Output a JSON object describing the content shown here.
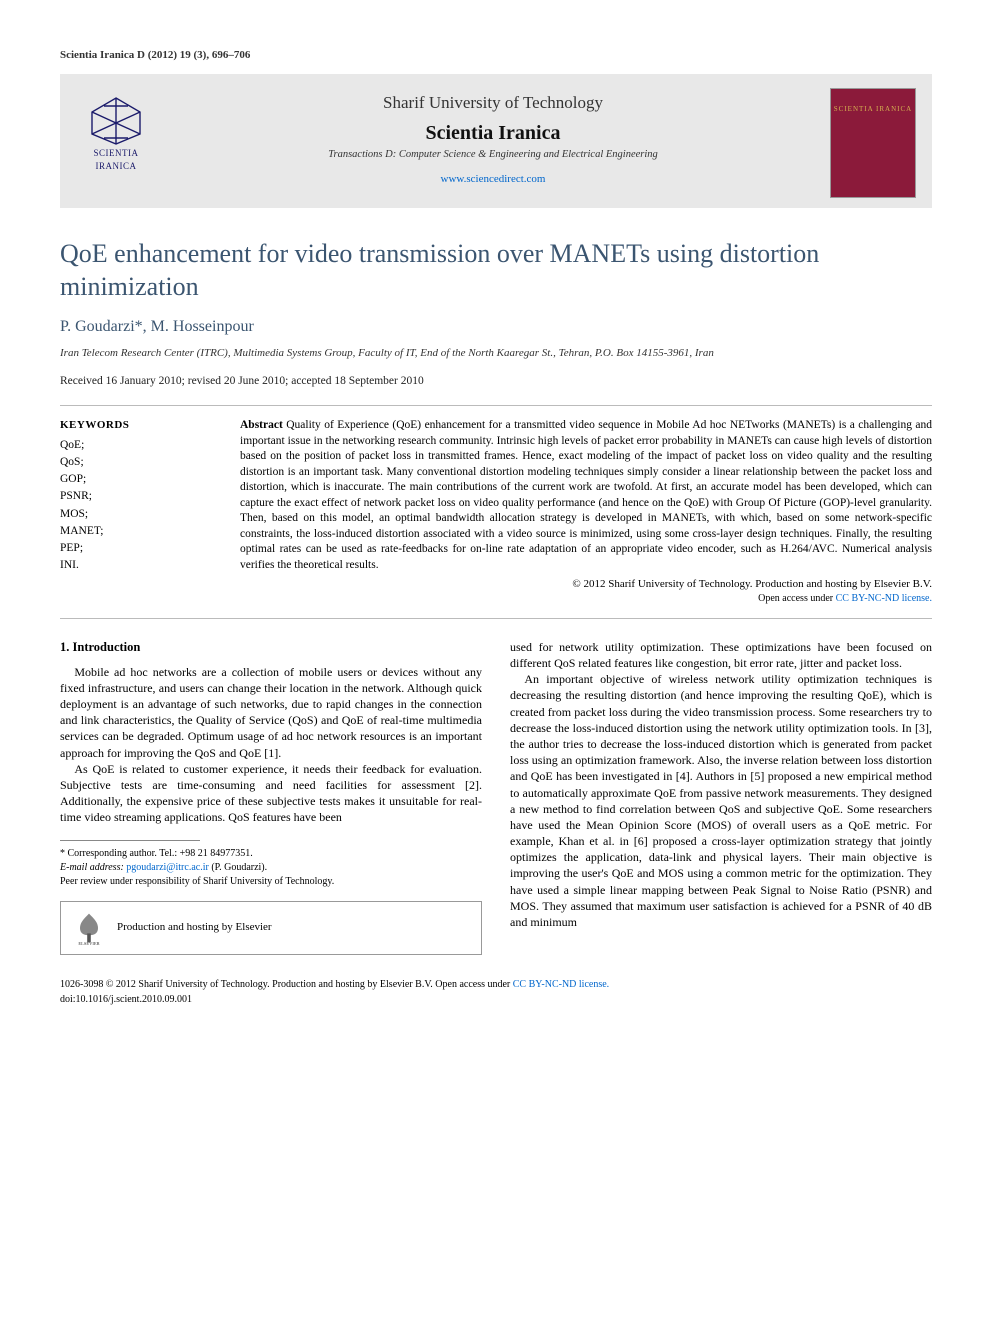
{
  "topline": "Scientia Iranica D (2012) 19 (3), 696–706",
  "header": {
    "logo_caption_l1": "SCIENTIA",
    "logo_caption_l2": "IRANICA",
    "university": "Sharif University of Technology",
    "journal": "Scientia Iranica",
    "transactions": "Transactions D: Computer Science & Engineering and Electrical Engineering",
    "website": "www.sciencedirect.com",
    "cover_label": "SCIENTIA IRANICA"
  },
  "title": "QoE enhancement for video transmission over MANETs using distortion minimization",
  "authors": "P. Goudarzi*, M. Hosseinpour",
  "affiliation": "Iran Telecom Research Center (ITRC), Multimedia Systems Group, Faculty of IT, End of the North Kaaregar St., Tehran, P.O. Box 14155-3961, Iran",
  "dates": "Received 16 January 2010; revised 20 June 2010; accepted 18 September 2010",
  "keywords": {
    "head": "KEYWORDS",
    "items": [
      "QoE;",
      "QoS;",
      "GOP;",
      "PSNR;",
      "MOS;",
      "MANET;",
      "PEP;",
      "INI."
    ]
  },
  "abstract": {
    "head": "Abstract",
    "text": " Quality of Experience (QoE) enhancement for a transmitted video sequence in Mobile Ad hoc NETworks (MANETs) is a challenging and important issue in the networking research community. Intrinsic high levels of packet error probability in MANETs can cause high levels of distortion based on the position of packet loss in transmitted frames. Hence, exact modeling of the impact of packet loss on video quality and the resulting distortion is an important task. Many conventional distortion modeling techniques simply consider a linear relationship between the packet loss and distortion, which is inaccurate. The main contributions of the current work are twofold. At first, an accurate model has been developed, which can capture the exact effect of network packet loss on video quality performance (and hence on the QoE) with Group Of Picture (GOP)-level granularity. Then, based on this model, an optimal bandwidth allocation strategy is developed in MANETs, with which, based on some network-specific constraints, the loss-induced distortion associated with a video source is minimized, using some cross-layer design techniques. Finally, the resulting optimal rates can be used as rate-feedbacks for on-line rate adaptation of an appropriate video encoder, such as H.264/AVC. Numerical analysis verifies the theoretical results.",
    "copyright": "© 2012 Sharif University of Technology. Production and hosting by Elsevier B.V.",
    "license_pre": "Open access under ",
    "license_link": "CC BY-NC-ND license."
  },
  "section1_head": "1.  Introduction",
  "col1_p1": "Mobile ad hoc networks are a collection of mobile users or devices without any fixed infrastructure, and users can change their location in the network. Although quick deployment is an advantage of such networks, due to rapid changes in the connection and link characteristics, the Quality of Service (QoS) and QoE of real-time multimedia services can be degraded. Optimum usage of ad hoc network resources is an important approach for improving the QoS and QoE [1].",
  "col1_p2": "As QoE is related to customer experience, it needs their feedback for evaluation. Subjective tests are time-consuming and need facilities for assessment [2]. Additionally, the expensive price of these subjective tests makes it unsuitable for real-time video streaming applications. QoS features have been",
  "col2_p1": "used for network utility optimization. These optimizations have been focused on different QoS related features like congestion, bit error rate, jitter and packet loss.",
  "col2_p2": "An important objective of wireless network utility optimization techniques is decreasing the resulting distortion (and hence improving the resulting QoE), which is created from packet loss during the video transmission process. Some researchers try to decrease the loss-induced distortion using the network utility optimization tools. In [3], the author tries to decrease the loss-induced distortion which is generated from packet loss using an optimization framework. Also, the inverse relation between loss distortion and QoE has been investigated in [4]. Authors in [5] proposed a new empirical method to automatically approximate QoE from passive network measurements. They designed a new method to find correlation between QoS and subjective QoE. Some researchers have used the Mean Opinion Score (MOS) of overall users as a QoE metric. For example, Khan et al. in [6] proposed a cross-layer optimization strategy that jointly optimizes the application, data-link and physical layers. Their main objective is improving the user's QoE and MOS using a common metric for the optimization. They have used a simple linear mapping between Peak Signal to Noise Ratio (PSNR) and MOS. They assumed that maximum user satisfaction is achieved for a PSNR of 40 dB and minimum",
  "footnotes": {
    "corr": "* Corresponding author. Tel.: +98 21 84977351.",
    "email_label": "E-mail address:",
    "email": "pgoudarzi@itrc.ac.ir",
    "email_who": "(P. Goudarzi).",
    "peer": "Peer review under responsibility of Sharif University of Technology."
  },
  "elsevier_label": "ELSEVIER",
  "elsevier_text": "Production and hosting by Elsevier",
  "bottom": {
    "issn": "1026-3098 © 2012 Sharif University of Technology. Production and hosting by Elsevier B.V.",
    "license_pre": "Open access under ",
    "license_link": "CC BY-NC-ND license.",
    "doi": "doi:10.1016/j.scient.2010.09.001"
  }
}
